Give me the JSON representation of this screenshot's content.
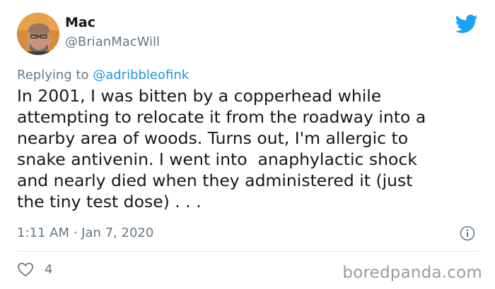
{
  "tweet": {
    "author_name": "Mac",
    "author_handle": "@BrianMacWill",
    "reply_prefix": "Replying to",
    "reply_to": "@adribbleofink",
    "text": "In 2001, I was bitten by a copperhead while\nattempting to relocate it from the roadway into a\nnearby area of woods. Turns out, I'm allergic to\nsnake antivenin. I went into  anaphylactic shock\nand nearly died when they administered it (just\nthe tiny test dose) . . .",
    "timestamp": "1:11 AM · Jan 7, 2020",
    "like_count": "4"
  },
  "icons": {
    "brand": "twitter-bird-icon",
    "info": "info-icon",
    "like": "heart-icon"
  },
  "watermark": "boredpanda.com",
  "colors": {
    "twitter_blue": "#1da1f2",
    "mention_blue": "#1b95e0",
    "secondary_text": "#657786",
    "primary_text": "#14171a",
    "divider": "#e1e8ed",
    "avatar_bg": "#d08a3c"
  }
}
